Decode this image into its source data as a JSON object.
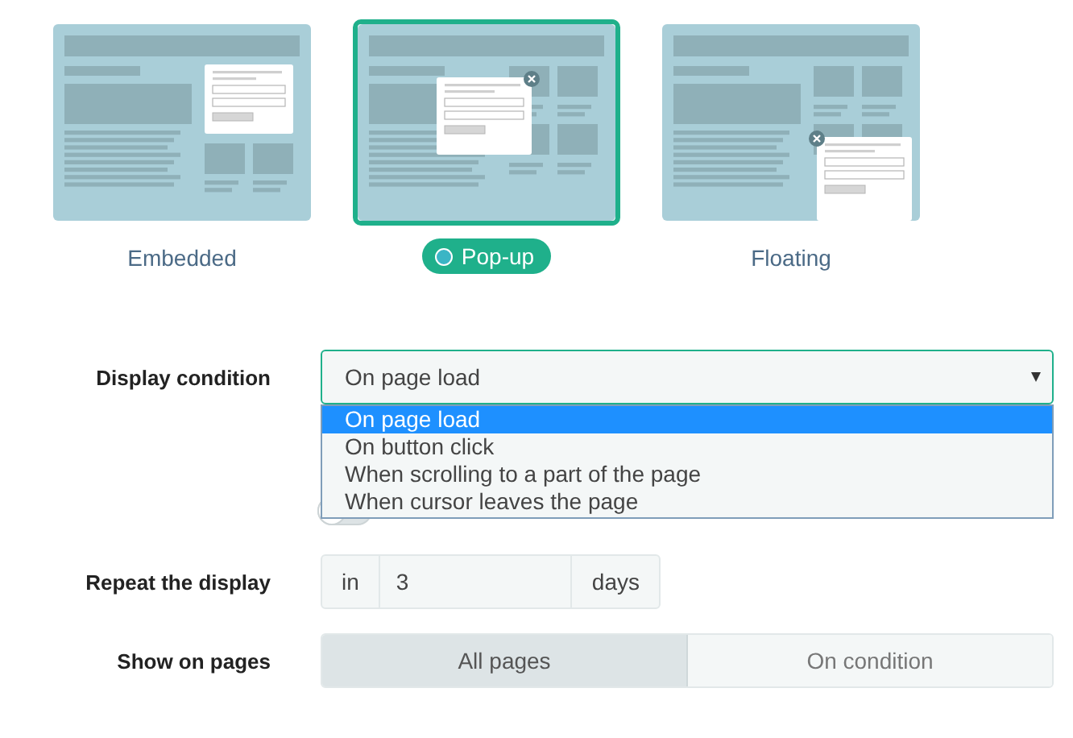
{
  "layout_options": [
    {
      "kind": "embedded",
      "label": "Embedded",
      "selected": false
    },
    {
      "kind": "popup",
      "label": "Pop-up",
      "selected": true
    },
    {
      "kind": "floating",
      "label": "Floating",
      "selected": false
    }
  ],
  "display_condition": {
    "label": "Display condition",
    "value": "On page load",
    "expanded": true,
    "options": [
      {
        "label": "On page load",
        "selected": true
      },
      {
        "label": "On button click",
        "selected": false
      },
      {
        "label": "When scrolling to a part of the page",
        "selected": false
      },
      {
        "label": "When cursor leaves the page",
        "selected": false
      }
    ]
  },
  "hide_on_mobile": {
    "on": false
  },
  "repeat": {
    "label": "Repeat the display",
    "prefix": "in",
    "value": "3",
    "suffix": "days"
  },
  "show_on_pages": {
    "label": "Show on pages",
    "options": [
      {
        "label": "All pages",
        "selected": true
      },
      {
        "label": "On condition",
        "selected": false
      }
    ]
  }
}
